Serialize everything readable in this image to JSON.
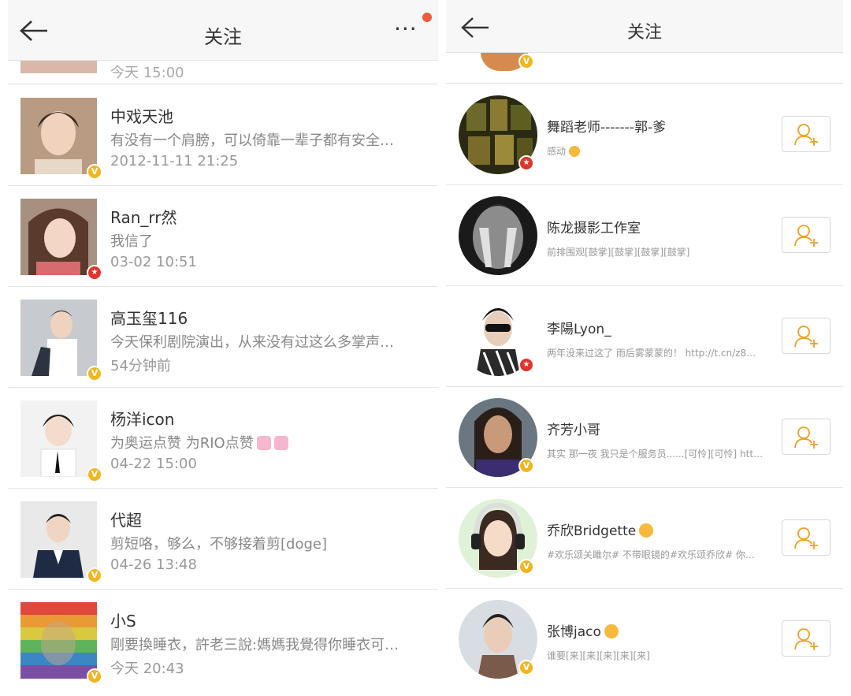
{
  "left": {
    "title": "关注",
    "partial_time": "今天 15:00",
    "rows": [
      {
        "name": "中戏天池",
        "msg": "有没有一个肩膀，可以倚靠一辈子都有安全…",
        "time": "2012-11-11 21:25",
        "badge": "v"
      },
      {
        "name": "Ran_rr然",
        "msg": "我信了",
        "time": "03-02 10:51",
        "badge": "s"
      },
      {
        "name": "高玉玺116",
        "msg": "今天保利剧院演出，从来没有过这么多掌声…",
        "time": "54分钟前",
        "badge": "v"
      },
      {
        "name": "杨洋icon",
        "msg": "为奥运点赞 为RIO点赞",
        "time": "04-22 15:00",
        "badge": "v"
      },
      {
        "name": "代超",
        "msg": "剪短咯，够么，不够接着剪[doge]",
        "time": "04-26 13:48",
        "badge": "v"
      },
      {
        "name": "小S",
        "msg": "剛要換睡衣，許老三說:媽媽我覺得你睡衣可…",
        "time": "今天 20:43",
        "badge": "v"
      }
    ]
  },
  "right": {
    "title": "关注",
    "rows": [
      {
        "name": "舞蹈老师-------郭-爹",
        "msg": "感动",
        "badge": "s"
      },
      {
        "name": "陈龙摄影工作室",
        "msg": "前排围观[鼓掌][鼓掌][鼓掌][鼓掌]",
        "badge": ""
      },
      {
        "name": "李陽Lyon_",
        "msg": "两年没来过这了 雨后雾蒙蒙的！ http://t.cn/z8…",
        "badge": "s"
      },
      {
        "name": "齐芳小哥",
        "msg": "其实 那一夜 我只是个服务员......[可怜][可怜] htt…",
        "badge": "v"
      },
      {
        "name": "乔欣Bridgette",
        "msg": "#欢乐颂关雎尔# 不带眼镜的#欢乐颂乔欣# 你…",
        "badge": "v"
      },
      {
        "name": "张博jaco",
        "msg": "谁要[来][来][来][来][来]",
        "badge": "v"
      }
    ]
  },
  "colors": {
    "verified": "#f2b51d",
    "star": "#e0342c",
    "notify_dot": "#f05a3e",
    "follow_icon": "#f0a020"
  },
  "icons": {
    "back": "arrow-left-icon",
    "more": "more-dots-icon",
    "follow": "add-user-icon"
  }
}
